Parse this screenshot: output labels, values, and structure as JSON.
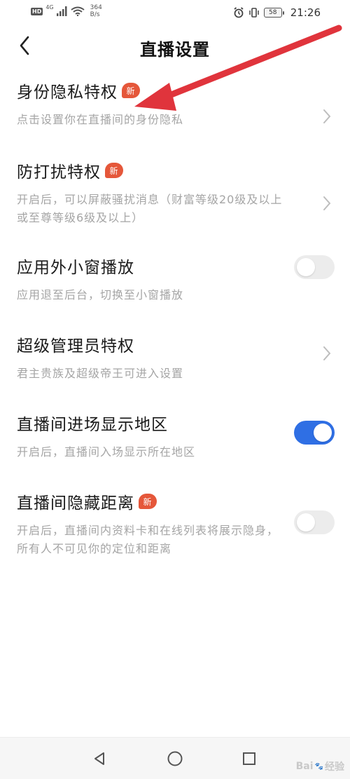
{
  "status_bar": {
    "hd": "HD",
    "network": "4G",
    "speed_value": "364",
    "speed_unit": "B/s",
    "battery": "58",
    "time": "21:26"
  },
  "header": {
    "title": "直播设置"
  },
  "settings": [
    {
      "title": "身份隐私特权",
      "badge": "新",
      "subtitle": "点击设置你在直播间的身份隐私",
      "control": "chevron"
    },
    {
      "title": "防打扰特权",
      "badge": "新",
      "subtitle": "开启后，可以屏蔽骚扰消息（财富等级20级及以上或至尊等级6级及以上）",
      "control": "chevron"
    },
    {
      "title": "应用外小窗播放",
      "subtitle": "应用退至后台，切换至小窗播放",
      "control": "toggle",
      "enabled": false
    },
    {
      "title": "超级管理员特权",
      "subtitle": "君主贵族及超级帝王可进入设置",
      "control": "chevron"
    },
    {
      "title": "直播间进场显示地区",
      "subtitle": "开启后，直播间入场显示所在地区",
      "control": "toggle",
      "enabled": true
    },
    {
      "title": "直播间隐藏距离",
      "badge": "新",
      "subtitle": "开启后，直播间内资料卡和在线列表将展示隐身，所有人不可见你的定位和距离",
      "control": "toggle",
      "enabled": false
    }
  ],
  "watermark": {
    "text": "Bai",
    "paw": "🐾",
    "text2": "经验"
  },
  "colors": {
    "accent": "#2f6fe4",
    "badge": "#e5573a",
    "annotation_arrow": "#e0343c"
  }
}
